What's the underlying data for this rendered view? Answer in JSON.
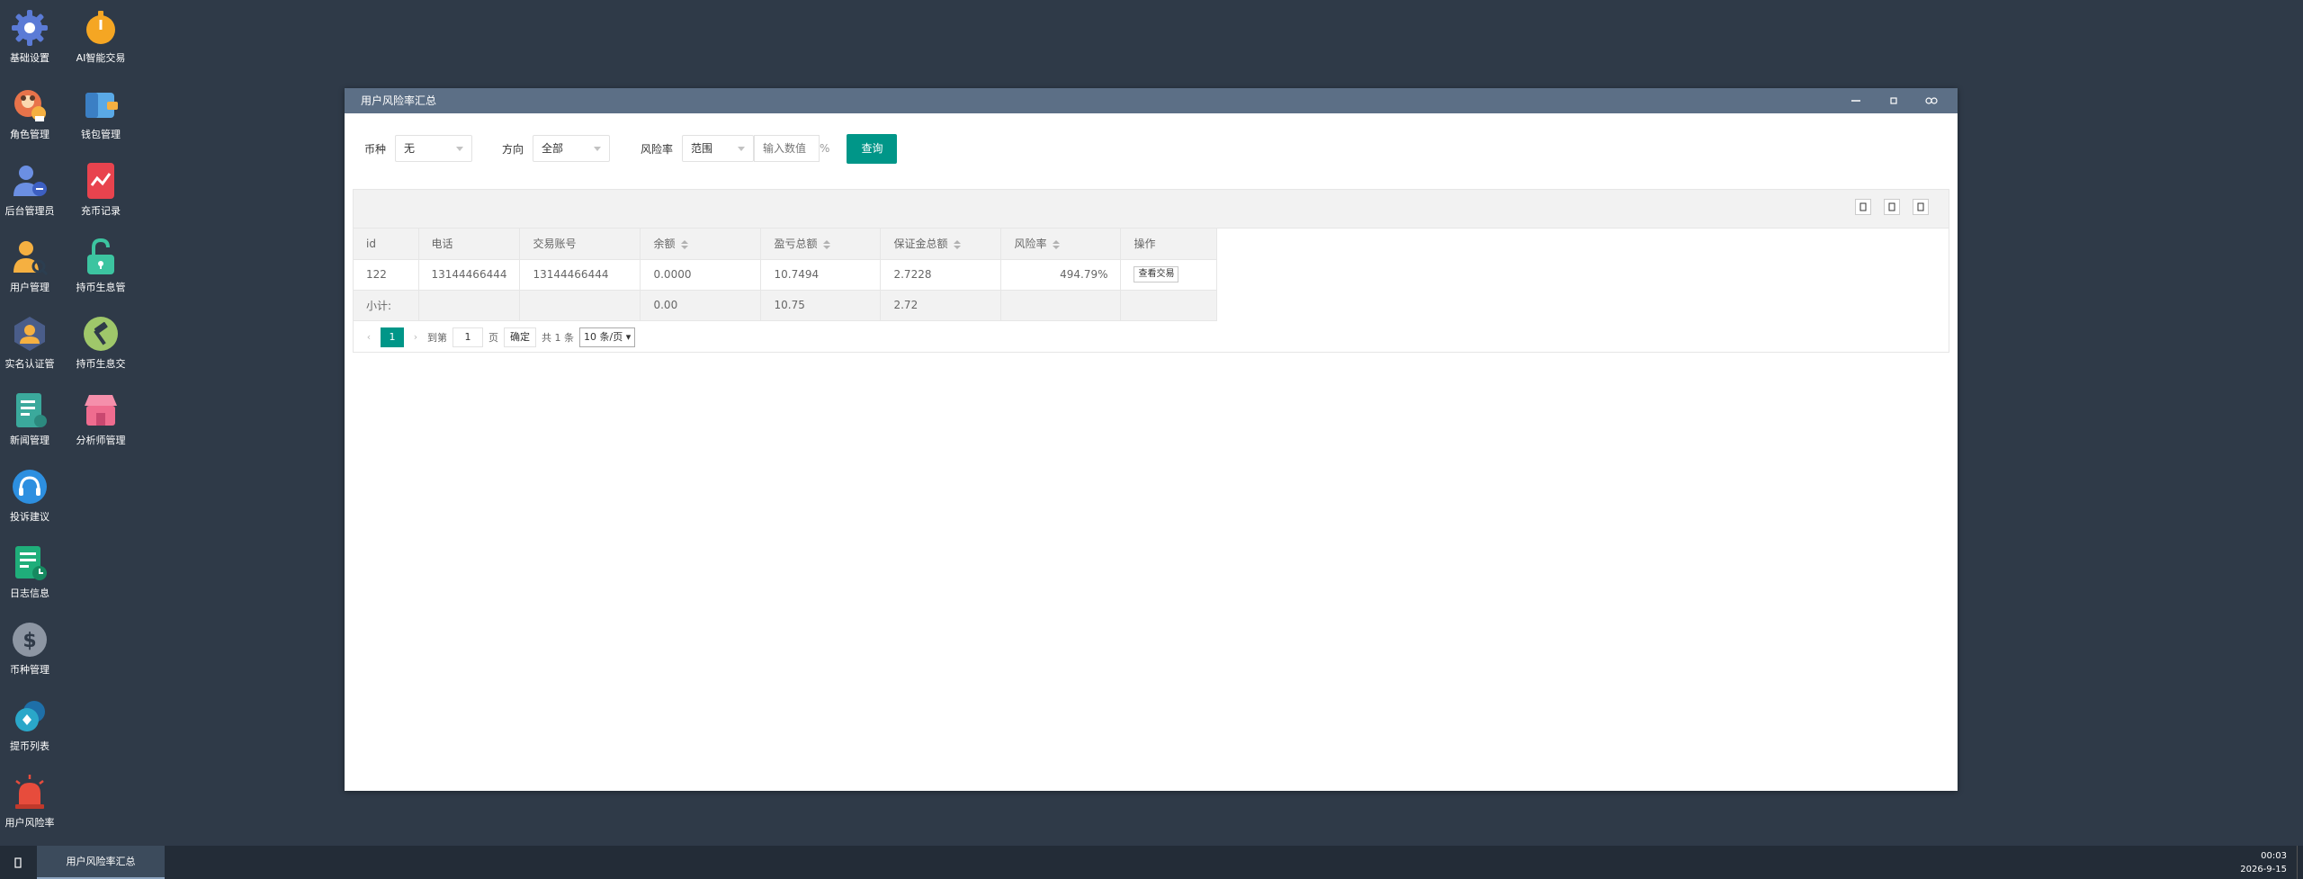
{
  "desktop": {
    "icons": [
      {
        "label": "基础设置",
        "icon": "gear-icon"
      },
      {
        "label": "AI智能交易",
        "icon": "timer-icon"
      },
      {
        "label": "角色管理",
        "icon": "role-icon"
      },
      {
        "label": "钱包管理",
        "icon": "wallet-icon"
      },
      {
        "label": "后台管理员",
        "icon": "admin-icon"
      },
      {
        "label": "充币记录",
        "icon": "chart-card-icon"
      },
      {
        "label": "用户管理",
        "icon": "user-search-icon"
      },
      {
        "label": "持币生息管",
        "icon": "unlock-icon"
      },
      {
        "label": "实名认证管",
        "icon": "id-verify-icon"
      },
      {
        "label": "持币生息交",
        "icon": "hammer-icon"
      },
      {
        "label": "新闻管理",
        "icon": "news-icon"
      },
      {
        "label": "分析师管理",
        "icon": "shop-icon"
      },
      {
        "label": "投诉建议",
        "icon": "headset-icon"
      },
      {
        "label": "日志信息",
        "icon": "log-icon"
      },
      {
        "label": "币种管理",
        "icon": "dollar-icon"
      },
      {
        "label": "提币列表",
        "icon": "withdraw-icon"
      },
      {
        "label": "用户风险率",
        "icon": "alarm-icon"
      }
    ]
  },
  "window": {
    "title": "用户风险率汇总",
    "filters": {
      "coin_label": "币种",
      "coin_value": "无",
      "direction_label": "方向",
      "direction_value": "全部",
      "risk_label": "风险率",
      "risk_range_value": "范围",
      "risk_input_placeholder": "输入数值",
      "percent_sign": "%",
      "query_button": "查询"
    },
    "table": {
      "columns": [
        "id",
        "电话",
        "交易账号",
        "余额",
        "盈亏总额",
        "保证金总额",
        "风险率",
        "操作"
      ],
      "rows": [
        {
          "id": "122",
          "phone": "13144466444",
          "account": "13144466444",
          "balance": "0.0000",
          "pnl": "10.7494",
          "margin": "2.7228",
          "risk": "494.79%",
          "action": "查看交易"
        }
      ],
      "subtotal": {
        "label": "小计:",
        "balance": "0.00",
        "pnl": "10.75",
        "margin": "2.72"
      }
    },
    "pager": {
      "prev": "‹",
      "current": "1",
      "next": "›",
      "goto_label": "到第",
      "goto_value": "1",
      "page_unit": "页",
      "confirm": "确定",
      "total": "共 1 条",
      "page_size": "10 条/页"
    }
  },
  "taskbar": {
    "active_task": "用户风险率汇总",
    "time": "00:03",
    "date": "2026-9-15"
  },
  "colors": {
    "accent": "#009688",
    "desktop": "#2f3a48",
    "titlebar": "#5c6f86",
    "taskbar": "#232c37"
  }
}
